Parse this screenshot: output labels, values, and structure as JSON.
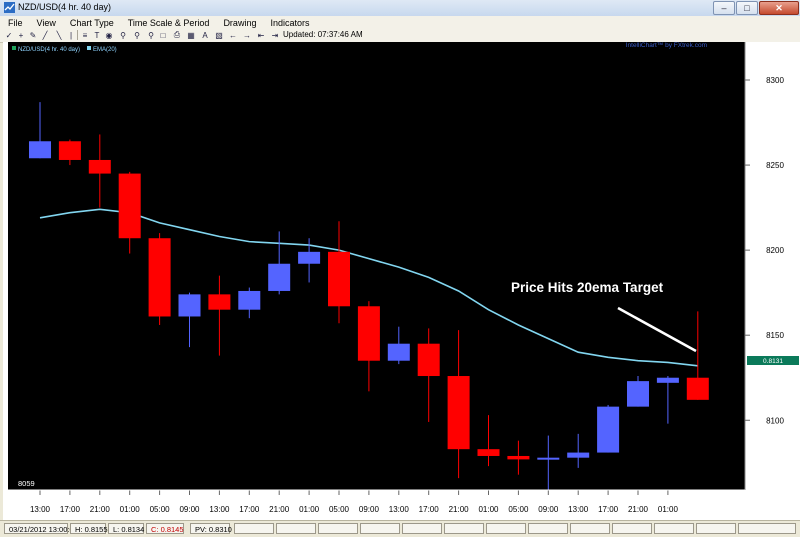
{
  "window": {
    "title": "NZD/USD(4 hr.  40 day)"
  },
  "menu": [
    "File",
    "View",
    "Chart Type",
    "Time Scale & Period",
    "Drawing",
    "Indicators"
  ],
  "toolbar": {
    "icons": [
      "cursor-icon",
      "crosshair-icon",
      "zoom-in-icon",
      "zoom-out-icon",
      "line-tool-icon",
      "text-tool-icon",
      "measure-icon",
      "fib-icon",
      "arrow-left-icon",
      "arrow-right-icon",
      "pan-left-icon",
      "pan-right-icon",
      "print-icon",
      "copy-icon",
      "grid-icon",
      "draw-icon",
      "fit-icon",
      "expand-icon",
      "refresh-icon"
    ],
    "updated": "Updated: 07:37:46 AM"
  },
  "chart": {
    "legend_symbol": "NZD/USD(4 hr.  40 day)",
    "legend_ema": "EMA(20)",
    "branding": "IntelliChart™ by FXtrek.com",
    "current_price_label": "0.8131",
    "low_label": "8059",
    "annotation": "Price Hits 20ema Target",
    "colors": {
      "background": "#000000",
      "up": "#5464ff",
      "down": "#ff0000",
      "ema": "#82d6f0",
      "axis_bg": "#ffffff",
      "price_tag": "#0b7a5a"
    }
  },
  "chart_data": {
    "type": "candlestick",
    "x": [
      "13:00",
      "17:00",
      "21:00",
      "01:00",
      "05:00",
      "09:00",
      "13:00",
      "17:00",
      "21:00",
      "01:00",
      "05:00",
      "09:00",
      "13:00",
      "17:00",
      "21:00",
      "01:00",
      "05:00",
      "09:00",
      "13:00",
      "17:00",
      "21:00",
      "01:00"
    ],
    "ylim": [
      8059,
      8310
    ],
    "yticks": [
      8100,
      8150,
      8200,
      8250,
      8300
    ],
    "candles": [
      {
        "o": 8254,
        "h": 8287,
        "l": 8254,
        "c": 8264
      },
      {
        "o": 8264,
        "h": 8265,
        "l": 8250,
        "c": 8253
      },
      {
        "o": 8253,
        "h": 8268,
        "l": 8225,
        "c": 8245
      },
      {
        "o": 8245,
        "h": 8246,
        "l": 8198,
        "c": 8207
      },
      {
        "o": 8207,
        "h": 8210,
        "l": 8156,
        "c": 8161
      },
      {
        "o": 8161,
        "h": 8175,
        "l": 8143,
        "c": 8174
      },
      {
        "o": 8174,
        "h": 8185,
        "l": 8138,
        "c": 8165
      },
      {
        "o": 8165,
        "h": 8178,
        "l": 8160,
        "c": 8176
      },
      {
        "o": 8176,
        "h": 8211,
        "l": 8174,
        "c": 8192
      },
      {
        "o": 8192,
        "h": 8207,
        "l": 8181,
        "c": 8199
      },
      {
        "o": 8199,
        "h": 8217,
        "l": 8157,
        "c": 8167
      },
      {
        "o": 8167,
        "h": 8170,
        "l": 8117,
        "c": 8135
      },
      {
        "o": 8135,
        "h": 8155,
        "l": 8133,
        "c": 8145
      },
      {
        "o": 8145,
        "h": 8154,
        "l": 8099,
        "c": 8126
      },
      {
        "o": 8126,
        "h": 8153,
        "l": 8066,
        "c": 8083
      },
      {
        "o": 8083,
        "h": 8103,
        "l": 8073,
        "c": 8079
      },
      {
        "o": 8079,
        "h": 8088,
        "l": 8068,
        "c": 8077
      },
      {
        "o": 8077,
        "h": 8091,
        "l": 8059,
        "c": 8078
      },
      {
        "o": 8078,
        "h": 8092,
        "l": 8072,
        "c": 8081
      },
      {
        "o": 8081,
        "h": 8109,
        "l": 8081,
        "c": 8108
      },
      {
        "o": 8108,
        "h": 8126,
        "l": 8108,
        "c": 8123
      },
      {
        "o": 8122,
        "h": 8126,
        "l": 8098,
        "c": 8125
      },
      {
        "o": 8125,
        "h": 8164,
        "l": 8112,
        "c": 8112
      }
    ],
    "ema": [
      8219,
      8222,
      8224,
      8222,
      8216,
      8212,
      8208,
      8205,
      8204,
      8203,
      8200,
      8195,
      8190,
      8184,
      8176,
      8165,
      8156,
      8148,
      8140,
      8137,
      8135,
      8134,
      8132
    ]
  }
}
